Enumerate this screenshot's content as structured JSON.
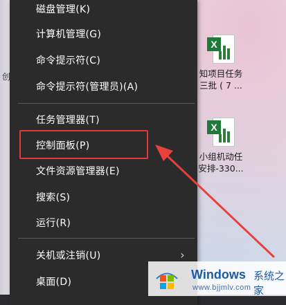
{
  "menu": {
    "items": [
      {
        "label": "磁盘管理(K)"
      },
      {
        "label": "计算机管理(G)"
      },
      {
        "label": "命令提示符(C)"
      },
      {
        "label": "命令提示符(管理员)(A)"
      },
      {
        "label": "任务管理器(T)"
      },
      {
        "label": "控制面板(P)"
      },
      {
        "label": "文件资源管理器(E)"
      },
      {
        "label": "搜索(S)"
      },
      {
        "label": "运行(R)"
      },
      {
        "label": "关机或注销(U)"
      },
      {
        "label": "桌面(D)"
      }
    ],
    "submenu_arrow": "›",
    "highlighted_item": "控制面板(P)"
  },
  "desktop": {
    "left_edge_glyph": "创",
    "icons": [
      {
        "line1": "知项目任务",
        "line2": "三批 ( 7 ...",
        "icon": "excel-icon"
      },
      {
        "line1": "小组机动任",
        "line2": "安排-330...",
        "icon": "excel-icon"
      }
    ]
  },
  "watermark": {
    "brand": "Windows",
    "cn_text": "系统之家",
    "url": "www.bjjmlv.com"
  },
  "colors": {
    "menu_bg": "#2b2b2b",
    "highlight_border": "#e03a3a",
    "arrow": "#e8403a",
    "excel_green": "#1f7a3a",
    "brand_blue": "#1c5aa8"
  }
}
